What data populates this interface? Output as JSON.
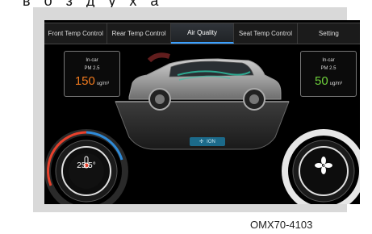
{
  "heading_text": "в о з д у х а",
  "tabs": [
    {
      "label": "Front Temp Control",
      "active": false
    },
    {
      "label": "Rear Temp Control",
      "active": false
    },
    {
      "label": "Air Quality",
      "active": true
    },
    {
      "label": "Seat Temp Control",
      "active": false
    },
    {
      "label": "Setting",
      "active": false
    }
  ],
  "left_panel": {
    "line1": "In-car",
    "line2": "PM 2.5",
    "value": "150",
    "unit": "ug/m³",
    "value_color": "#f07a1e"
  },
  "right_panel": {
    "line1": "In-car",
    "line2": "PM 2.5",
    "value": "50",
    "unit": "ug/m³",
    "value_color": "#6fd23c"
  },
  "ion_label": "ION",
  "temperature_value": "25.5°",
  "fan_level": "4",
  "figure_code": "OMX70-4103",
  "colors": {
    "accent": "#3aa0ff",
    "hot": "#e8412c",
    "cool": "#2f8bd8"
  },
  "icons": {
    "thermometer": "thermometer-icon",
    "fan": "fan-icon",
    "ion": "ion-icon"
  }
}
